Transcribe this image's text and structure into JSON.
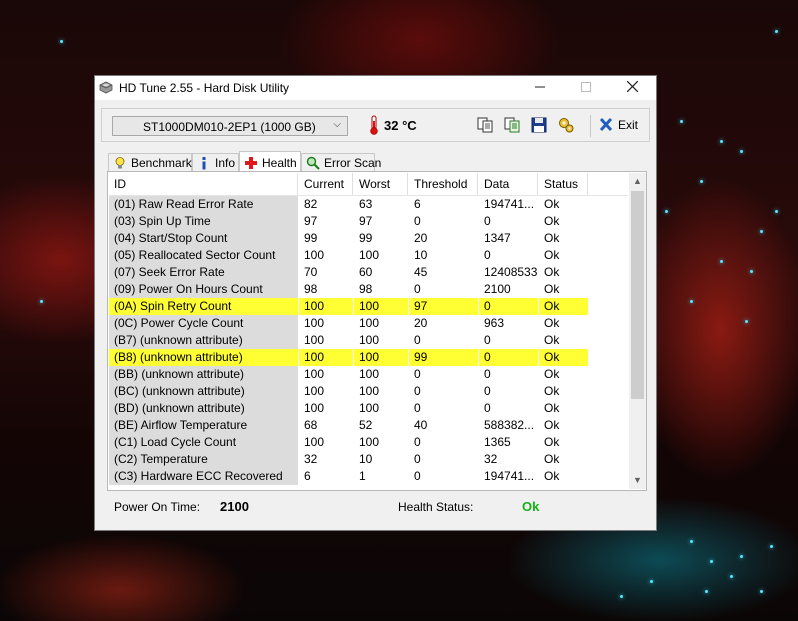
{
  "window": {
    "title": "HD Tune 2.55 - Hard Disk Utility"
  },
  "toolbar": {
    "drive": "ST1000DM010-2EP1 (1000 GB)",
    "temperature": "32 °C",
    "exit_label": "Exit",
    "accent_color": "#1f5fbf"
  },
  "tabs": [
    {
      "label": "Benchmark",
      "icon": "lightbulb-icon"
    },
    {
      "label": "Info",
      "icon": "info-icon"
    },
    {
      "label": "Health",
      "icon": "red-cross-icon",
      "active": true
    },
    {
      "label": "Error Scan",
      "icon": "magnifier-icon"
    }
  ],
  "table": {
    "headers": [
      "ID",
      "Current",
      "Worst",
      "Threshold",
      "Data",
      "Status"
    ],
    "highlight_color": "#ffff33",
    "rows": [
      {
        "id": "(01) Raw Read Error Rate",
        "current": "82",
        "worst": "63",
        "threshold": "6",
        "data": "194741...",
        "status": "Ok"
      },
      {
        "id": "(03) Spin Up Time",
        "current": "97",
        "worst": "97",
        "threshold": "0",
        "data": "0",
        "status": "Ok"
      },
      {
        "id": "(04) Start/Stop Count",
        "current": "99",
        "worst": "99",
        "threshold": "20",
        "data": "1347",
        "status": "Ok"
      },
      {
        "id": "(05) Reallocated Sector Count",
        "current": "100",
        "worst": "100",
        "threshold": "10",
        "data": "0",
        "status": "Ok"
      },
      {
        "id": "(07) Seek Error Rate",
        "current": "70",
        "worst": "60",
        "threshold": "45",
        "data": "12408533",
        "status": "Ok"
      },
      {
        "id": "(09) Power On Hours Count",
        "current": "98",
        "worst": "98",
        "threshold": "0",
        "data": "2100",
        "status": "Ok"
      },
      {
        "id": "(0A) Spin Retry Count",
        "current": "100",
        "worst": "100",
        "threshold": "97",
        "data": "0",
        "status": "Ok",
        "highlight": true
      },
      {
        "id": "(0C) Power Cycle Count",
        "current": "100",
        "worst": "100",
        "threshold": "20",
        "data": "963",
        "status": "Ok"
      },
      {
        "id": "(B7) (unknown attribute)",
        "current": "100",
        "worst": "100",
        "threshold": "0",
        "data": "0",
        "status": "Ok"
      },
      {
        "id": "(B8) (unknown attribute)",
        "current": "100",
        "worst": "100",
        "threshold": "99",
        "data": "0",
        "status": "Ok",
        "highlight": true
      },
      {
        "id": "(BB) (unknown attribute)",
        "current": "100",
        "worst": "100",
        "threshold": "0",
        "data": "0",
        "status": "Ok"
      },
      {
        "id": "(BC) (unknown attribute)",
        "current": "100",
        "worst": "100",
        "threshold": "0",
        "data": "0",
        "status": "Ok"
      },
      {
        "id": "(BD) (unknown attribute)",
        "current": "100",
        "worst": "100",
        "threshold": "0",
        "data": "0",
        "status": "Ok"
      },
      {
        "id": "(BE) Airflow Temperature",
        "current": "68",
        "worst": "52",
        "threshold": "40",
        "data": "588382...",
        "status": "Ok"
      },
      {
        "id": "(C1) Load Cycle Count",
        "current": "100",
        "worst": "100",
        "threshold": "0",
        "data": "1365",
        "status": "Ok"
      },
      {
        "id": "(C2) Temperature",
        "current": "32",
        "worst": "10",
        "threshold": "0",
        "data": "32",
        "status": "Ok"
      },
      {
        "id": "(C3) Hardware ECC Recovered",
        "current": "6",
        "worst": "1",
        "threshold": "0",
        "data": "194741...",
        "status": "Ok"
      }
    ]
  },
  "status": {
    "power_on_label": "Power On Time:",
    "power_on_value": "2100",
    "health_label": "Health Status:",
    "health_value": "Ok",
    "health_color": "#16b016"
  }
}
